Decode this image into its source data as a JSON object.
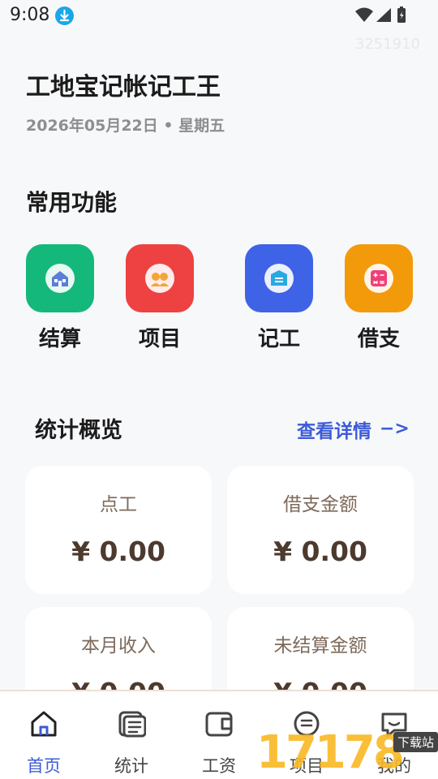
{
  "status_bar": {
    "time": "9:08",
    "download_icon": "download-icon",
    "icons": [
      "wifi-icon",
      "signal-icon",
      "battery-icon"
    ]
  },
  "watermark_id": "3251910",
  "header": {
    "title": "工地宝记帐记工王",
    "date": "2026年05月22日 • 星期五"
  },
  "common_functions": {
    "title": "常用功能",
    "items": [
      {
        "label": "结算",
        "icon": "settlement-icon",
        "color": "#14b87b"
      },
      {
        "label": "项目",
        "icon": "project-icon",
        "color": "#ee4242"
      },
      {
        "label": "记工",
        "icon": "worklog-icon",
        "color": "#3f63e6"
      },
      {
        "label": "借支",
        "icon": "advance-icon",
        "color": "#f39a0b"
      }
    ]
  },
  "stats": {
    "title": "统计概览",
    "detail_link": "查看详情",
    "detail_arrow": "−>",
    "cards": [
      {
        "label": "点工",
        "value": "¥ 0.00"
      },
      {
        "label": "借支金额",
        "value": "¥ 0.00"
      },
      {
        "label": "本月收入",
        "value": "¥ 0.00"
      },
      {
        "label": "未结算金额",
        "value": "¥ 0.00"
      }
    ]
  },
  "bottom_nav": {
    "items": [
      {
        "label": "首页",
        "icon": "home-icon",
        "active": true
      },
      {
        "label": "统计",
        "icon": "stats-icon",
        "active": false
      },
      {
        "label": "工资",
        "icon": "wallet-icon",
        "active": false
      },
      {
        "label": "项目",
        "icon": "project-nav-icon",
        "active": false
      },
      {
        "label": "我的",
        "icon": "profile-icon",
        "active": false
      }
    ],
    "active_color": "#3d5bd8"
  },
  "site_watermark": {
    "number": "17178",
    "suffix": "COM",
    "tag": "下载站"
  }
}
